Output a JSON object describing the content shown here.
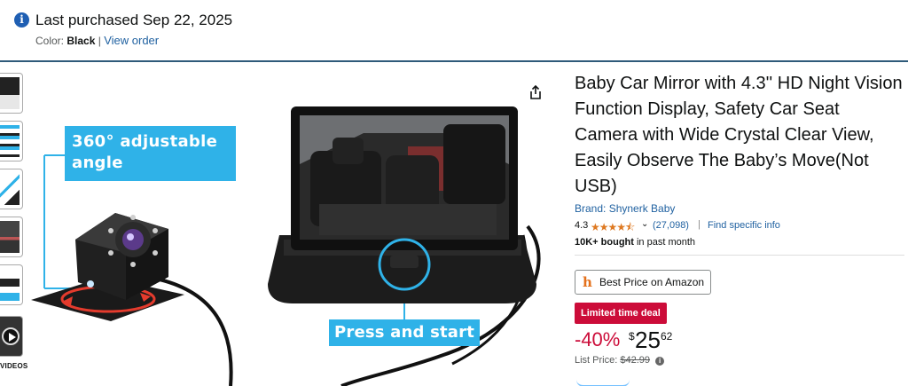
{
  "banner": {
    "title": "Last purchased Sep 22, 2025",
    "color_label": "Color:",
    "color_value": "Black",
    "separator": "|",
    "view_order": "View order"
  },
  "gallery": {
    "thumbnail_count": 5,
    "videos_label": "VIDEOS",
    "callout_angle": "360° adjustable angle",
    "callout_press": "Press and start"
  },
  "product": {
    "title": "Baby Car Mirror with 4.3'' HD Night Vision Function Display, Safety Car Seat Camera with Wide Crystal Clear View, Easily Observe The Baby’s Move(Not USB)",
    "brand": "Brand: Shynerk Baby",
    "rating": "4.3",
    "stars": "★★★★⯪",
    "rating_count": "(27,098)",
    "rating_sep": "|",
    "find_info": "Find specific info",
    "bought_bold": "10K+ bought",
    "bought_rest": " in past month",
    "best_price_button": "Best Price on Amazon",
    "deal_badge": "Limited time deal",
    "discount": "-40%",
    "currency": "$",
    "price_whole": "25",
    "price_fraction": "62",
    "list_price_label": "List Price:",
    "list_price": "$42.99"
  },
  "colors": {
    "link": "#2162a1",
    "deal_red": "#cc0c39",
    "star": "#de7921",
    "callout_blue": "#2fb2e8"
  }
}
